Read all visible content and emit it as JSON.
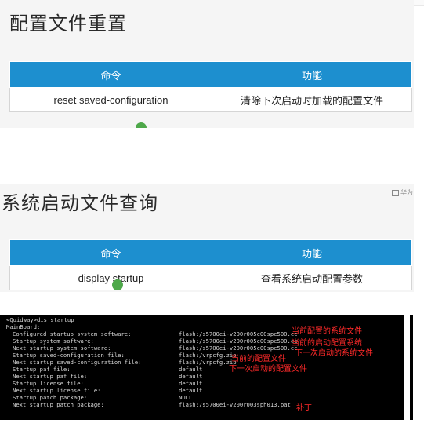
{
  "slide1": {
    "title": "配置文件重置",
    "table": {
      "headers": [
        "命令",
        "功能"
      ],
      "rows": [
        [
          "reset saved-configuration",
          "清除下次启动时加载的配置文件"
        ]
      ]
    }
  },
  "slide2": {
    "title": "系统启动文件查询",
    "corner_label": "华为",
    "table": {
      "headers": [
        "命令",
        "功能"
      ],
      "rows": [
        [
          "display startup",
          "查看系统启动配置参数"
        ]
      ]
    }
  },
  "terminal": {
    "prompt": "<Quidway>dis startup",
    "section": "MainBoard:",
    "lines": [
      {
        "key": "Configured startup system software:",
        "value": "flash:/s5700ei-v200r005c00spc500.cc"
      },
      {
        "key": "Startup system software:",
        "value": "flash:/s5700ei-v200r005c00spc500.cc"
      },
      {
        "key": "Next startup system software:",
        "value": "flash:/s5700ei-v200r005c00spc500.cc"
      },
      {
        "key": "Startup saved-configuration file:",
        "value": "flash:/vrpcfg.zip"
      },
      {
        "key": "Next startup saved-configuration file:",
        "value": "flash:/vrpcfg.zip"
      },
      {
        "key": "Startup paf file:",
        "value": "default"
      },
      {
        "key": "Next startup paf file:",
        "value": "default"
      },
      {
        "key": "Startup license file:",
        "value": "default"
      },
      {
        "key": "Next startup license file:",
        "value": "default"
      },
      {
        "key": "Startup patch package:",
        "value": "NULL"
      },
      {
        "key": "Next startup patch package:",
        "value": "flash:/s5700ei-v200r003sph013.pat"
      }
    ],
    "annotations": {
      "current_software": "当前配置的系统文件",
      "current_startup": "当前的启动配置系统",
      "next_software": "下一次启动的系统文件",
      "current_config": "当前的配置文件",
      "next_config": "下一次启动的配置文件",
      "patch": "补丁"
    }
  },
  "colors": {
    "table_header": "#1d8fcf",
    "annotation": "#ff2a2a",
    "terminal_bg": "#000000",
    "pointer_dot": "#4ea84a"
  }
}
